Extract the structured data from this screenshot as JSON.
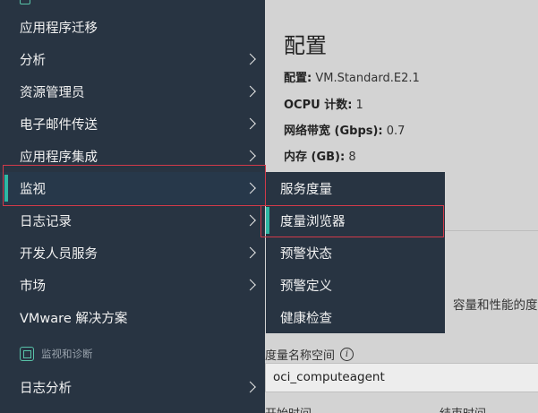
{
  "nav": {
    "top_cut_label": "...",
    "items": [
      {
        "label": "应用程序迁移",
        "has_submenu": false
      },
      {
        "label": "分析",
        "has_submenu": true
      },
      {
        "label": "资源管理员",
        "has_submenu": true
      },
      {
        "label": "电子邮件传送",
        "has_submenu": true
      },
      {
        "label": "应用程序集成",
        "has_submenu": true
      },
      {
        "label": "监视",
        "has_submenu": true,
        "active": true
      },
      {
        "label": "日志记录",
        "has_submenu": true
      },
      {
        "label": "开发人员服务",
        "has_submenu": true
      },
      {
        "label": "市场",
        "has_submenu": true
      },
      {
        "label": "VMware 解决方案",
        "has_submenu": false
      }
    ],
    "section_label": "监视和诊断",
    "section_items": [
      {
        "label": "日志分析",
        "has_submenu": true
      }
    ]
  },
  "submenu": {
    "items": [
      {
        "label": "服务度量"
      },
      {
        "label": "度量浏览器",
        "active": true
      },
      {
        "label": "预警状态"
      },
      {
        "label": "预警定义"
      },
      {
        "label": "健康检查"
      }
    ]
  },
  "content": {
    "config_title": "配置",
    "shape_label": "配置:",
    "shape_value": "VM.Standard.E2.1",
    "ocpu_label": "OCPU 计数:",
    "ocpu_value": "1",
    "bandwidth_label": "网络带宽 (Gbps):",
    "bandwidth_value": "0.7",
    "memory_label": "内存 (GB):",
    "memory_value": "8",
    "side_text": "容量和性能的度",
    "namespace_label": "度量名称空间",
    "namespace_value": "oci_computeagent",
    "start_time_label": "开始时间",
    "end_time_label": "结束时间"
  },
  "colors": {
    "nav_bg": "#283442",
    "accent": "#2fb8a4",
    "highlight_border": "#d23a4a",
    "content_bg": "#d3d3d3"
  }
}
